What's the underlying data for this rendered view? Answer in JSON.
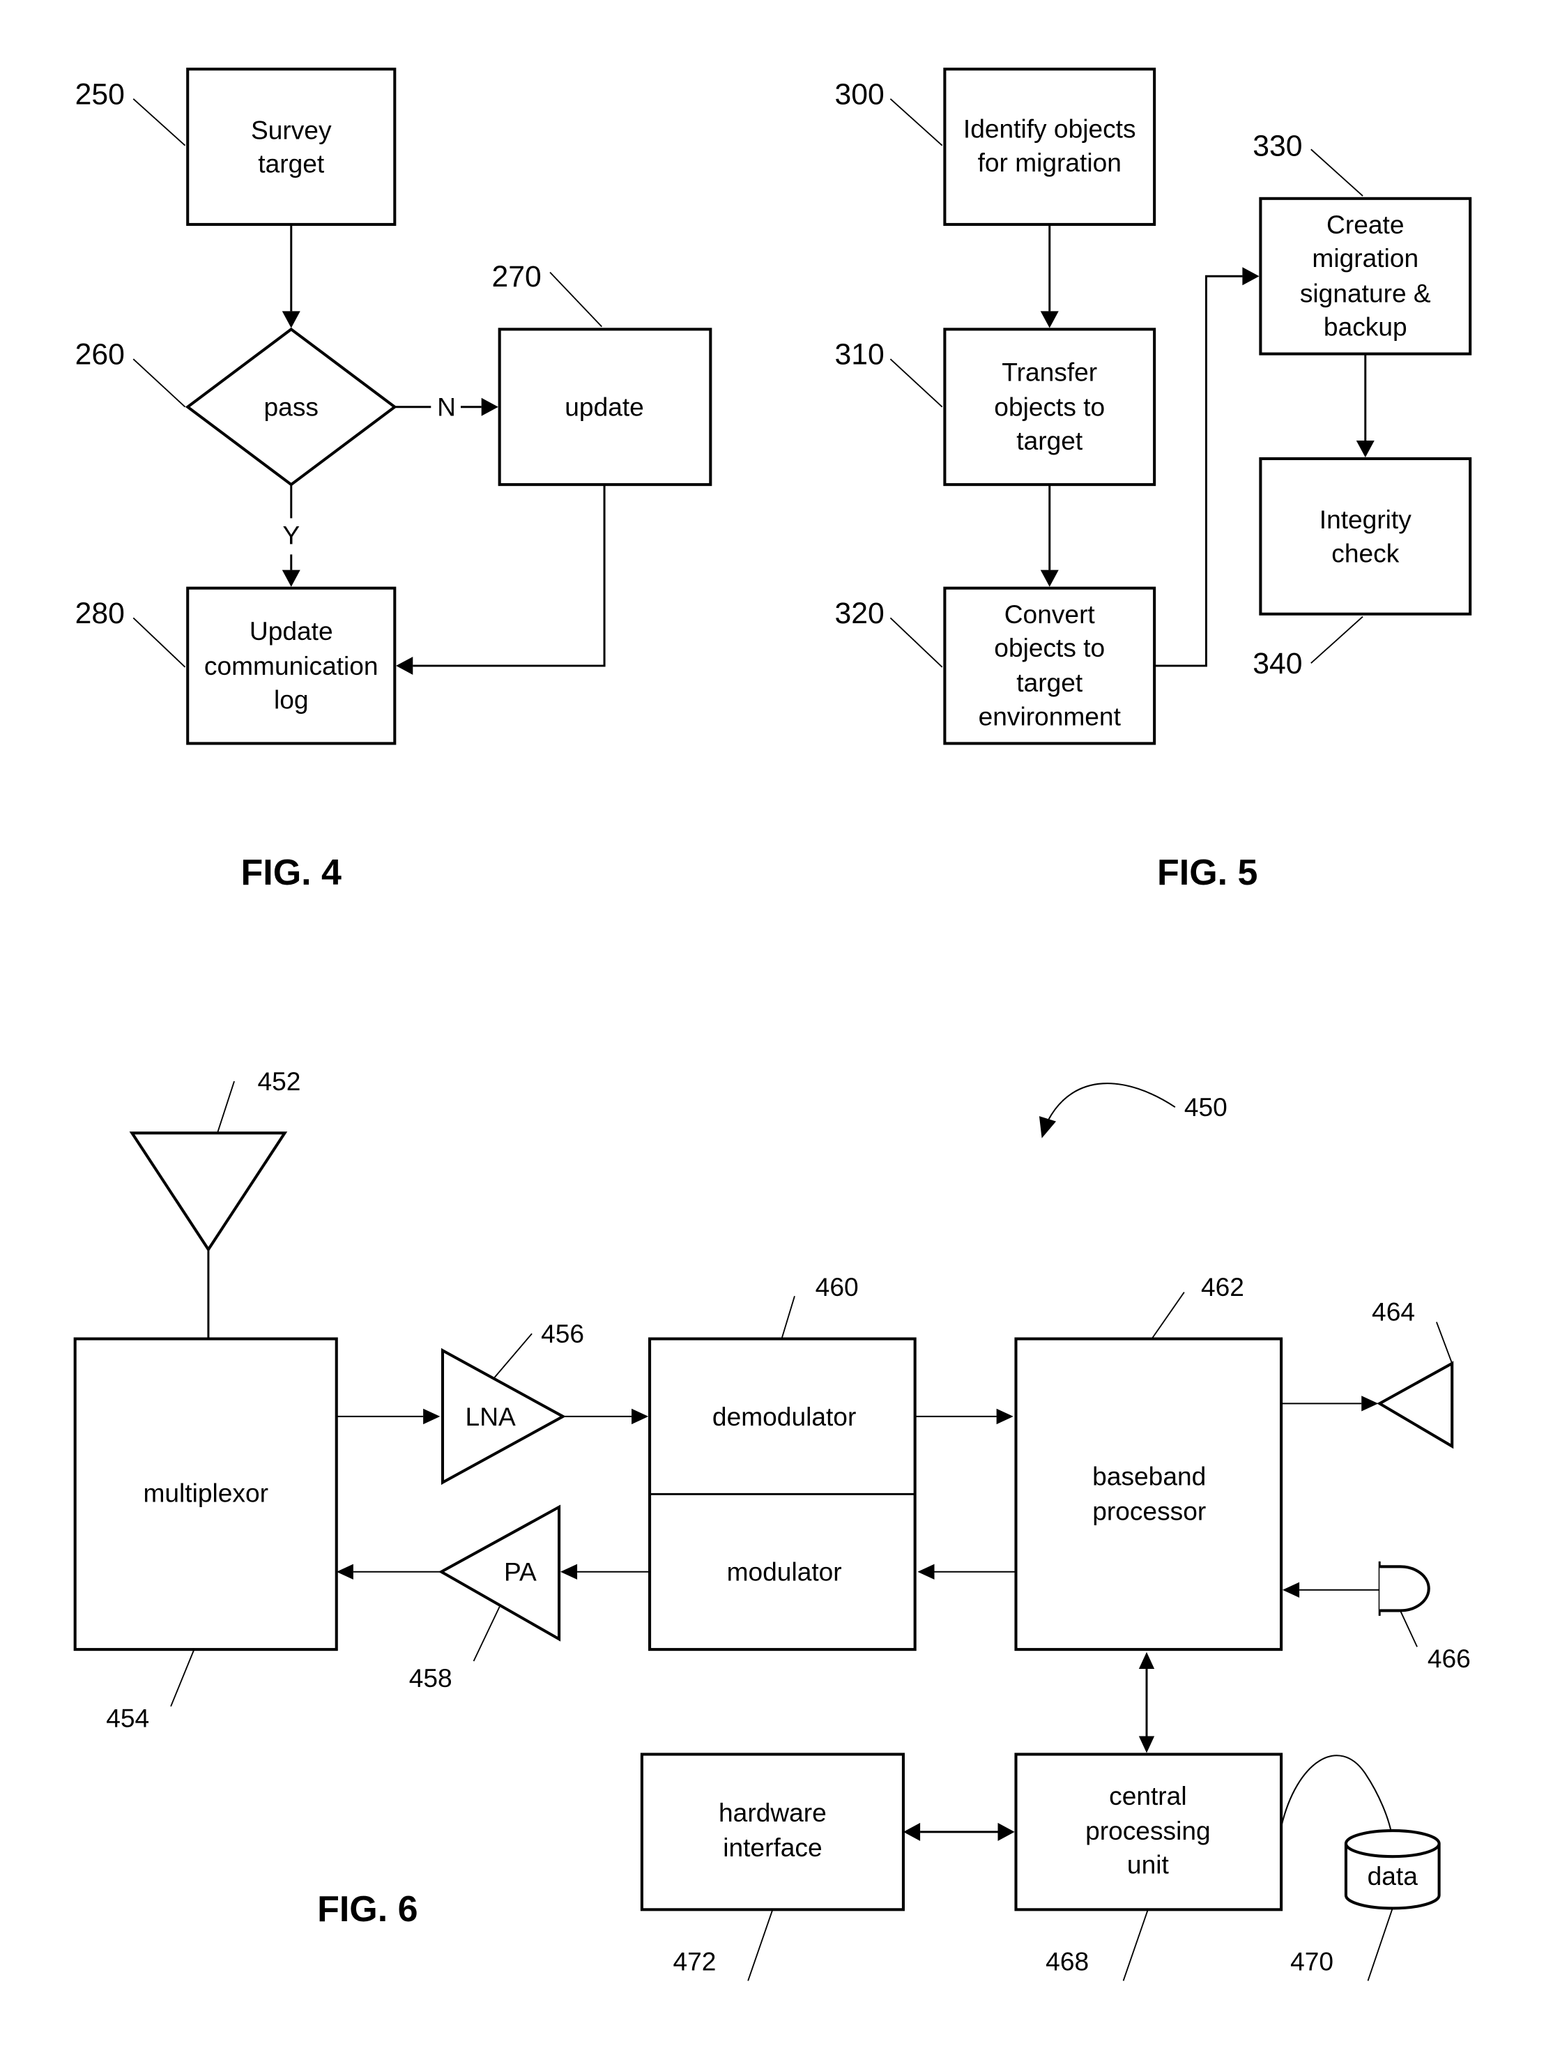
{
  "fig4": {
    "caption": "FIG. 4",
    "nodes": {
      "survey": {
        "ref": "250",
        "lines": [
          "Survey",
          "target"
        ]
      },
      "pass": {
        "ref": "260",
        "lines": [
          "pass"
        ]
      },
      "update": {
        "ref": "270",
        "lines": [
          "update"
        ]
      },
      "log": {
        "ref": "280",
        "lines": [
          "Update",
          "communication",
          "log"
        ]
      }
    },
    "edge_labels": {
      "no": "N",
      "yes": "Y"
    }
  },
  "fig5": {
    "caption": "FIG. 5",
    "nodes": {
      "identify": {
        "ref": "300",
        "lines": [
          "Identify objects",
          "for migration"
        ]
      },
      "transfer": {
        "ref": "310",
        "lines": [
          "Transfer",
          "objects to",
          "target"
        ]
      },
      "convert": {
        "ref": "320",
        "lines": [
          "Convert",
          "objects to",
          "target",
          "environment"
        ]
      },
      "signature": {
        "ref": "330",
        "lines": [
          "Create",
          "migration",
          "signature &",
          "backup"
        ]
      },
      "integrity": {
        "ref": "340",
        "lines": [
          "Integrity",
          "check"
        ]
      }
    }
  },
  "fig6": {
    "caption": "FIG. 6",
    "system_ref": "450",
    "components": {
      "antenna": {
        "ref": "452"
      },
      "multiplexor": {
        "ref": "454",
        "lines": [
          "multiplexor"
        ]
      },
      "lna": {
        "ref": "456",
        "lines": [
          "LNA"
        ]
      },
      "pa": {
        "ref": "458",
        "lines": [
          "PA"
        ]
      },
      "demodulator": {
        "ref": "460",
        "lines": [
          "demodulator"
        ]
      },
      "modulator": {
        "lines": [
          "modulator"
        ]
      },
      "baseband": {
        "ref": "462",
        "lines": [
          "baseband",
          "processor"
        ]
      },
      "speaker": {
        "ref": "464"
      },
      "microphone": {
        "ref": "466"
      },
      "cpu": {
        "ref": "468",
        "lines": [
          "central",
          "processing",
          "unit"
        ]
      },
      "data_store": {
        "ref": "470",
        "lines": [
          "data"
        ]
      },
      "hardware_interface": {
        "ref": "472",
        "lines": [
          "hardware",
          "interface"
        ]
      }
    }
  }
}
